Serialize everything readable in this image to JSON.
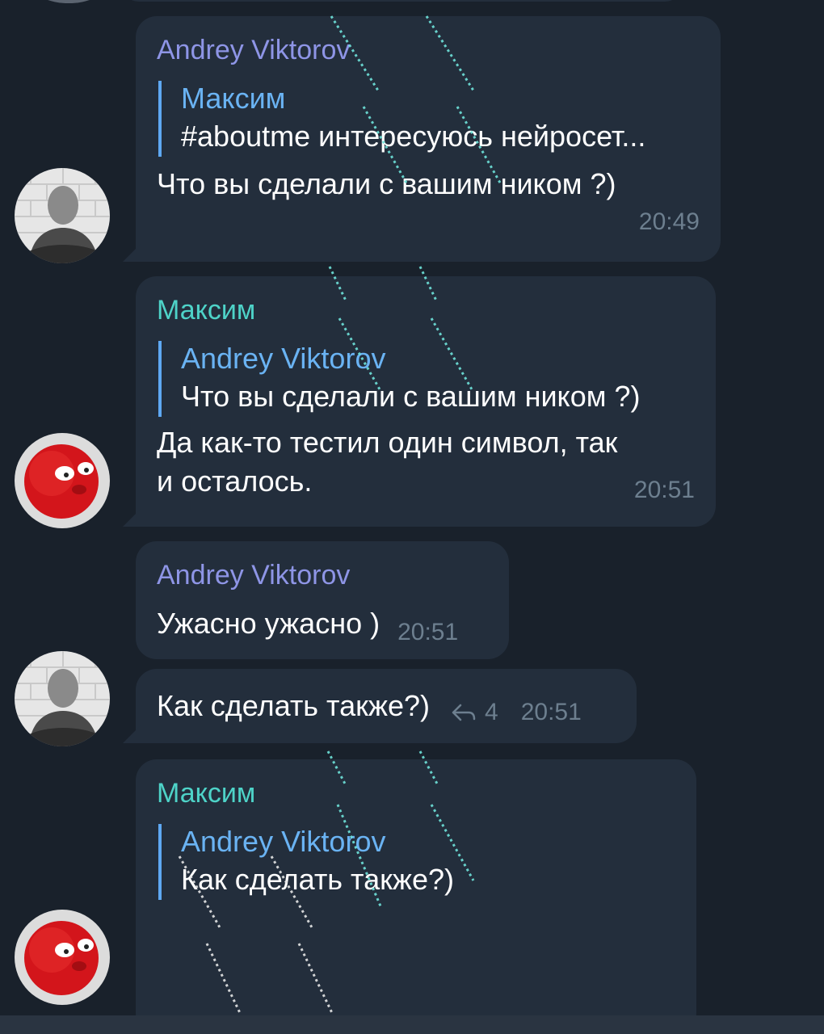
{
  "colors": {
    "background": "#19212b",
    "bubble": "#232e3c",
    "sender_andrey": "#8e95e6",
    "sender_maksim": "#4ed3c8",
    "quote_accent": "#5ea8f2",
    "time": "#6d7f8f"
  },
  "messages": [
    {
      "sender": "Andrey Viktorov",
      "quote_name": "Максим",
      "quote_text": "#aboutme интересуюсь нейросет...",
      "text": "Что вы сделали с вашим ником ?)",
      "time": "20:49"
    },
    {
      "sender": "Максим",
      "quote_name": "Andrey Viktorov",
      "quote_text": "Что вы сделали с вашим ником ?)",
      "text_line1": "Да как-то тестил один символ, так",
      "text_line2": "и осталось.",
      "time": "20:51"
    },
    {
      "sender": "Andrey Viktorov",
      "text": "Ужасно ужасно )",
      "time": "20:51"
    },
    {
      "text": "Как сделать также?)",
      "reply_icon": "reply-arrow-icon",
      "reply_count": "4",
      "time": "20:51"
    },
    {
      "sender": "Максим",
      "quote_name": "Andrey Viktorov",
      "quote_text": "Как сделать также?)"
    }
  ]
}
